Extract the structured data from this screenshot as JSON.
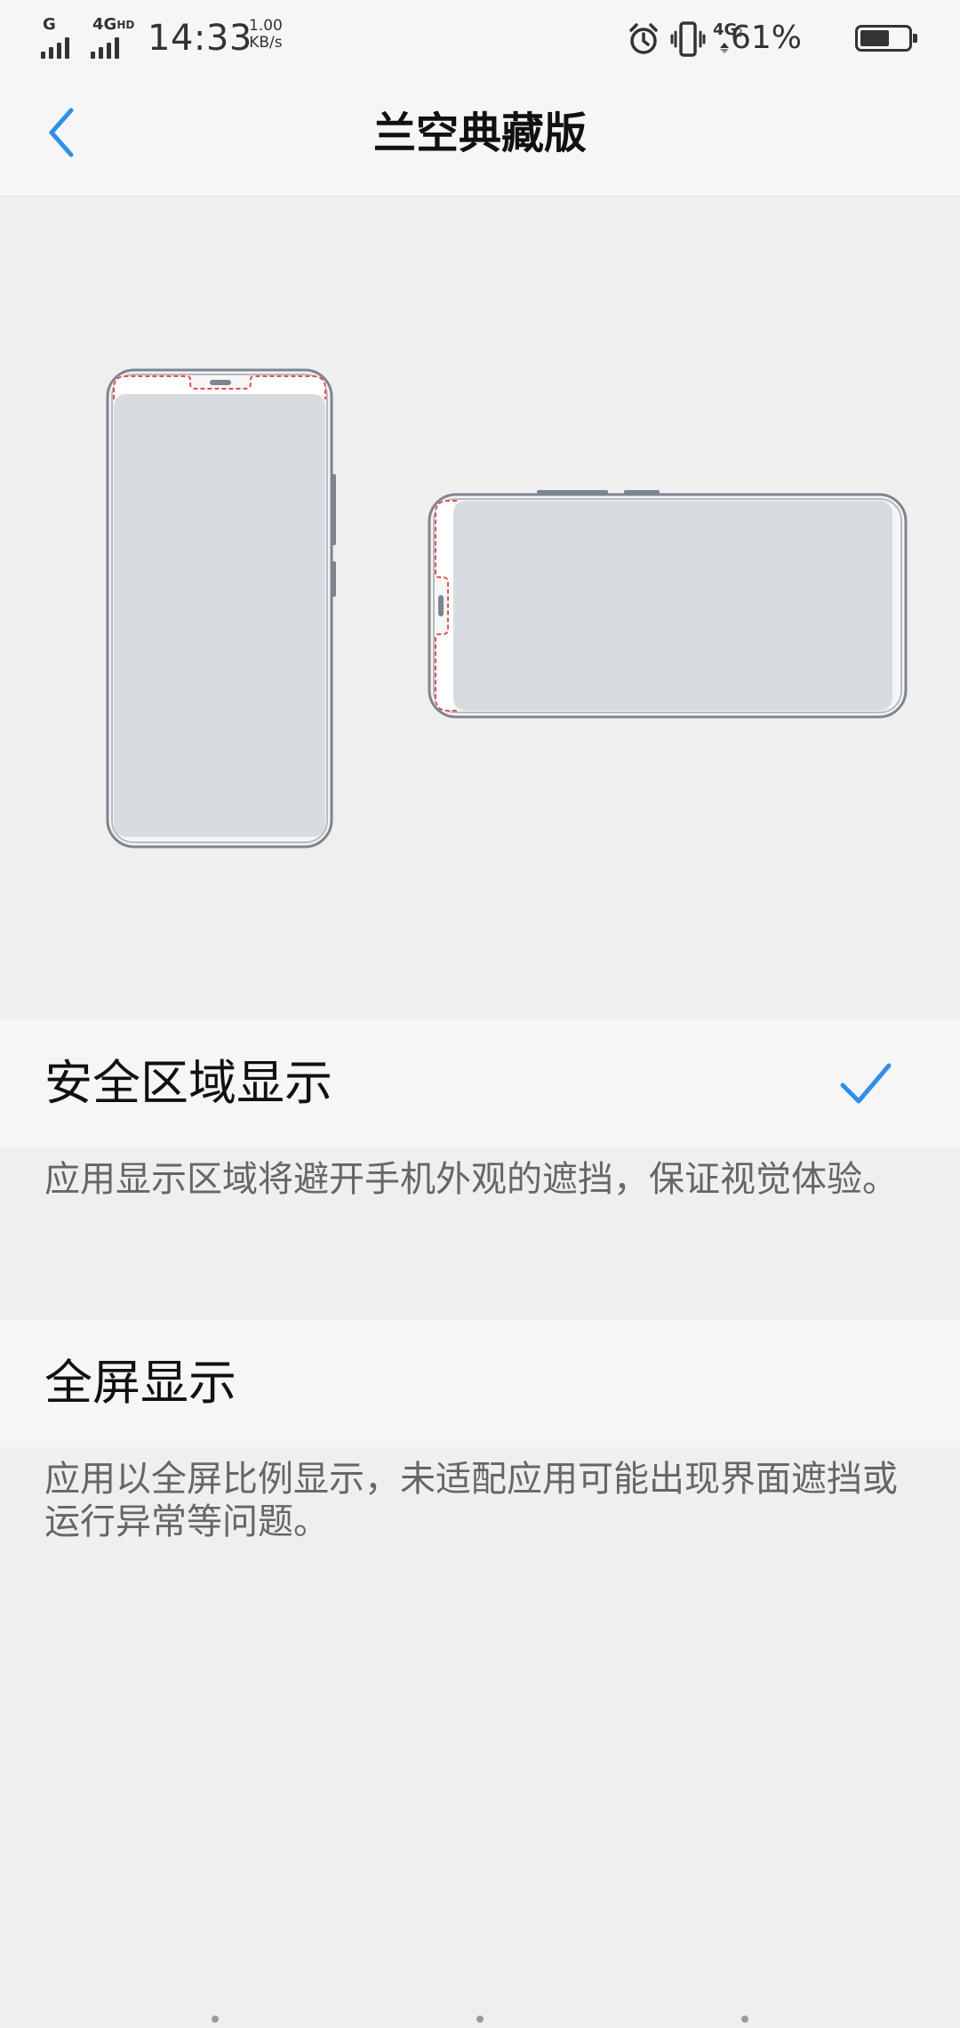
{
  "status_bar": {
    "sim1_network": "G",
    "sim2_network": "4G",
    "sim2_hd": "HD",
    "time": "14:33",
    "speed_value": "1.00",
    "speed_unit": "KB/s",
    "data_network": "4G",
    "data_sim": "2",
    "battery_percent": "61%",
    "battery_level": 0.61,
    "icons": [
      "signal-icon",
      "alarm-icon",
      "vibrate-icon",
      "battery-icon"
    ]
  },
  "header": {
    "back_icon": "chevron-left-icon",
    "title": "兰空典藏版"
  },
  "options": [
    {
      "label": "安全区域显示",
      "description": "应用显示区域将避开手机外观的遮挡，保证视觉体验。",
      "selected": true
    },
    {
      "label": "全屏显示",
      "description": "应用以全屏比例显示，未适配应用可能出现界面遮挡或运行异常等问题。",
      "selected": false
    }
  ],
  "colors": {
    "accent": "#2f8fe8",
    "notch_outline": "#e05252",
    "phone_frame": "#7d8590",
    "screen": "#d8dce0"
  }
}
